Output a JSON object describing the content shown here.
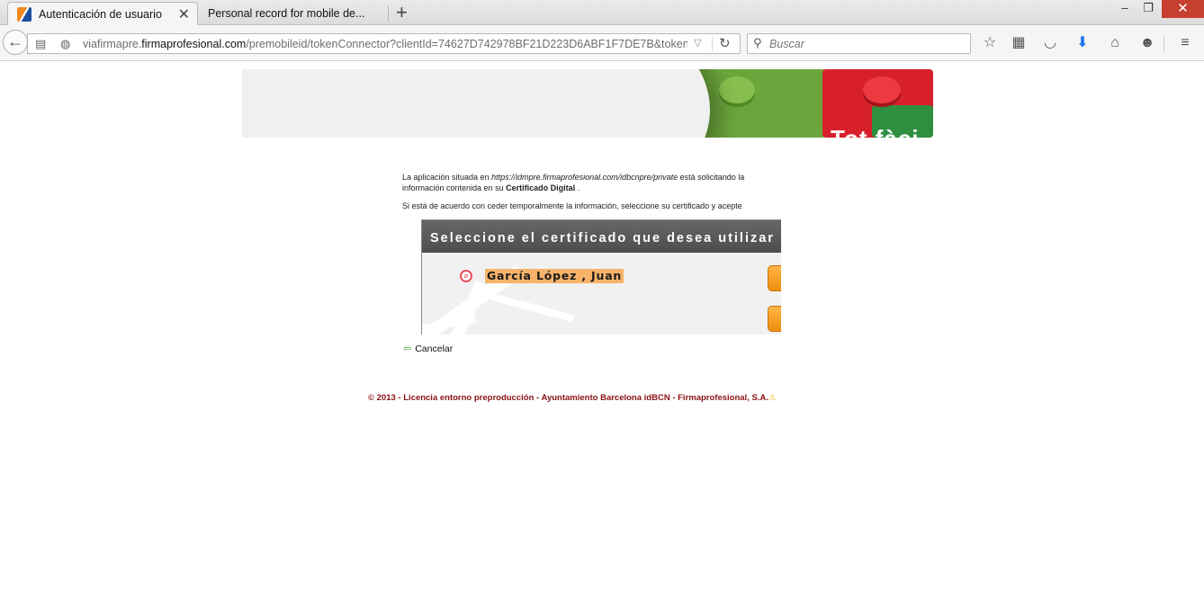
{
  "browser": {
    "tabs": [
      {
        "title": "Autenticación de usuario",
        "active": true
      },
      {
        "title": "Personal record for mobile de...",
        "active": false
      }
    ],
    "url": {
      "prefix": "viafirmapre.",
      "domain": "firmaprofesional.com",
      "path": "/premobileid/tokenConnector?clientId=74627D742978BF21D223D6ABF1F7DE7B&token=AES|F"
    },
    "search_placeholder": "Buscar",
    "window_controls": {
      "minimize": "‒",
      "restore": "❐",
      "close": "✕"
    }
  },
  "banner": {
    "text": "Tot fàci"
  },
  "intro": {
    "part1": "La aplicación situada en ",
    "url": "https://idmpre.firmaprofesional.com/idbcnpre/private",
    "part2": " está solicitando la información contenida en su ",
    "cert": "Certificado Digital",
    "part3": " .",
    "line2": "Si está de acuerdo con ceder temporalmente la información, seleccione su certificado y acepte"
  },
  "cert_panel": {
    "header": "Seleccione el certificado que desea utilizar",
    "certificates": [
      "García López , Juan"
    ]
  },
  "cancel_label": "Cancelar",
  "footer": {
    "text": "© 2013 - Licencia entorno preproducción - Ayuntamiento Barcelona idBCN - Firmaprofesional, S.A.",
    "warn_icon": "⚠"
  },
  "colors": {
    "accent_orange": "#f7b36a",
    "button_orange": "#ef8e0d",
    "footer_red": "#8b1111",
    "close_red": "#c7402f",
    "download_blue": "#1a73e8"
  }
}
